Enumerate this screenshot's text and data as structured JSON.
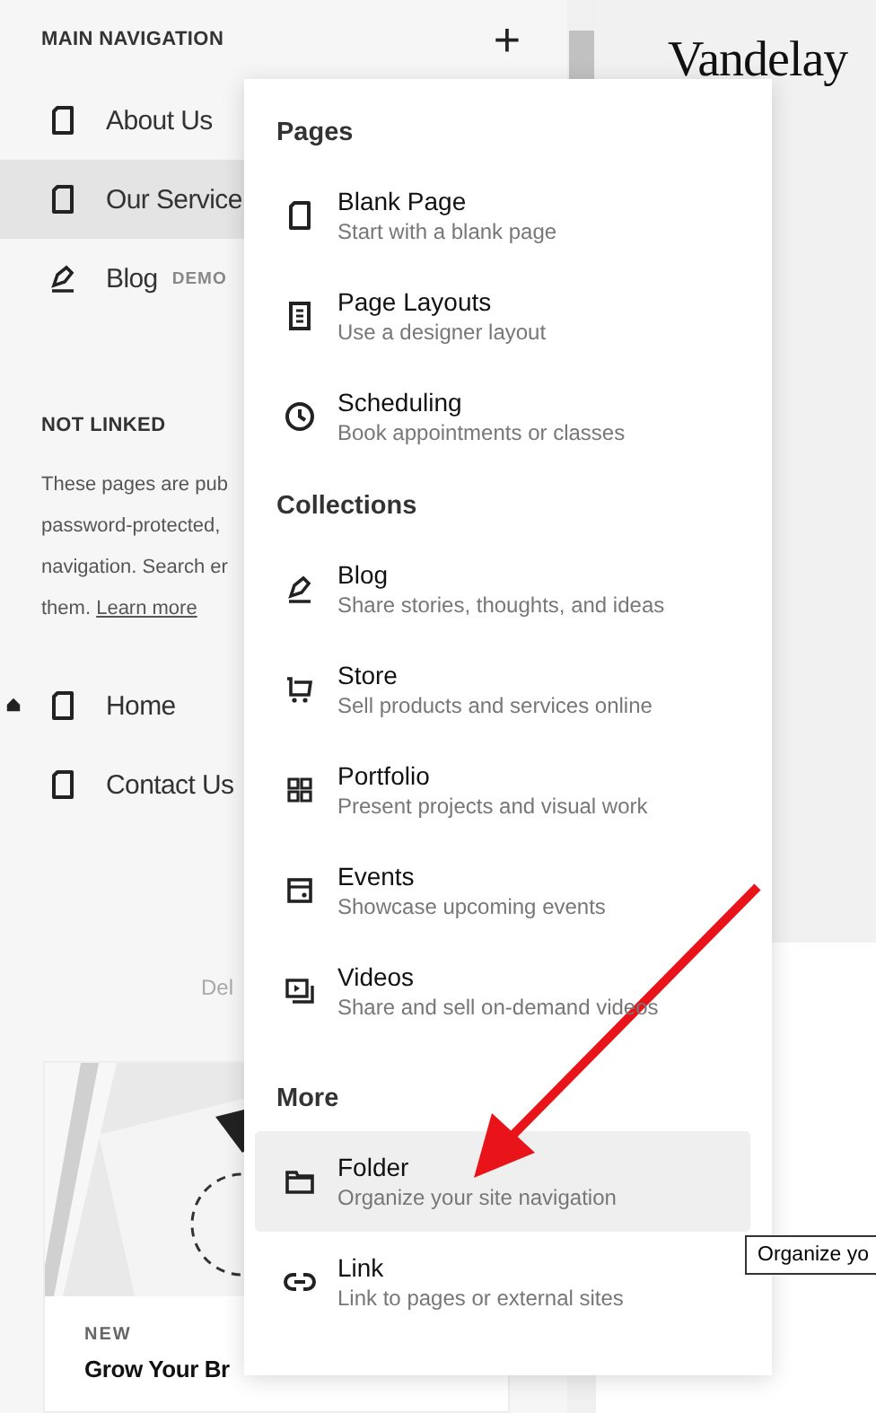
{
  "sidebar": {
    "main_heading": "MAIN NAVIGATION",
    "add_button": "+",
    "main_items": [
      {
        "label": "About Us",
        "kind": "page",
        "selected": false
      },
      {
        "label": "Our Service",
        "kind": "page",
        "selected": true
      },
      {
        "label": "Blog",
        "badge": "DEMO",
        "kind": "blog",
        "selected": false
      }
    ],
    "not_linked_heading": "NOT LINKED",
    "not_linked_lines": [
      "These pages are pub",
      "password-protected,",
      "navigation. Search er"
    ],
    "not_linked_last": "them.",
    "learn_more": "Learn more",
    "not_linked_items": [
      {
        "label": "Home",
        "kind": "page",
        "home": true,
        "selected": false
      },
      {
        "label": "Contact Us",
        "kind": "page",
        "home": false,
        "selected": false
      }
    ],
    "delete_text": "Del"
  },
  "site_title": "Vandelay",
  "card": {
    "eyebrow": "NEW",
    "title": "Grow Your Br"
  },
  "menu": {
    "sections": [
      {
        "heading": "Pages",
        "items": [
          {
            "kind": "page",
            "title": "Blank Page",
            "description": "Start with a blank page",
            "highlighted": false
          },
          {
            "kind": "layout",
            "title": "Page Layouts",
            "description": "Use a designer layout",
            "highlighted": false
          },
          {
            "kind": "clock",
            "title": "Scheduling",
            "description": "Book appointments or classes",
            "highlighted": false
          }
        ]
      },
      {
        "heading": "Collections",
        "items": [
          {
            "kind": "blog",
            "title": "Blog",
            "description": "Share stories, thoughts, and ideas",
            "highlighted": false
          },
          {
            "kind": "cart",
            "title": "Store",
            "description": "Sell products and services online",
            "highlighted": false
          },
          {
            "kind": "grid",
            "title": "Portfolio",
            "description": "Present projects and visual work",
            "highlighted": false
          },
          {
            "kind": "events",
            "title": "Events",
            "description": "Showcase upcoming events",
            "highlighted": false
          },
          {
            "kind": "video",
            "title": "Videos",
            "description": "Share and sell on-demand videos",
            "highlighted": false
          }
        ]
      },
      {
        "heading": "More",
        "items": [
          {
            "kind": "folder",
            "title": "Folder",
            "description": "Organize your site navigation",
            "highlighted": true
          },
          {
            "kind": "link",
            "title": "Link",
            "description": "Link to pages or external sites",
            "highlighted": false
          }
        ]
      }
    ]
  },
  "tooltip": "Organize yo"
}
